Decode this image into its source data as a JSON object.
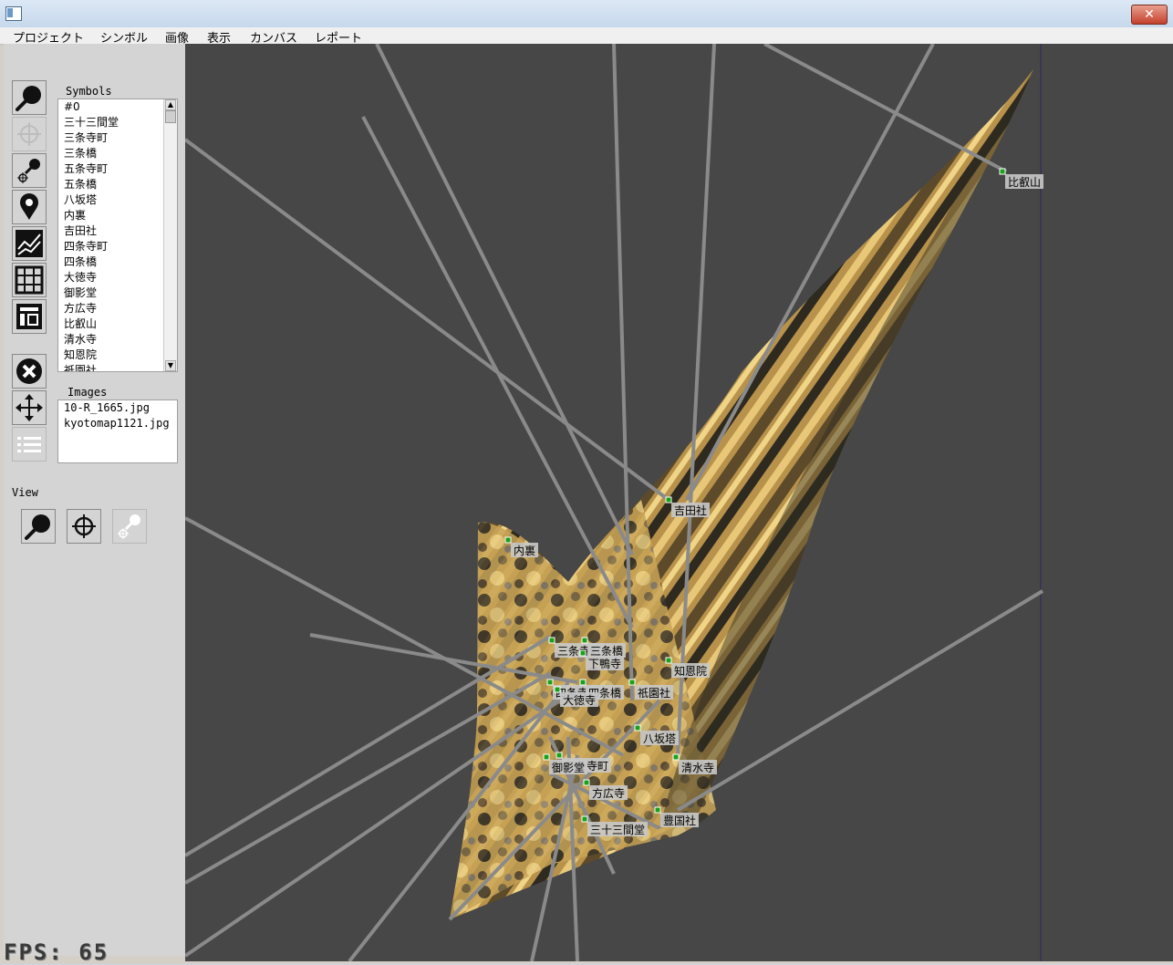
{
  "window": {
    "close_label": "✕"
  },
  "menu": [
    "プロジェクト",
    "シンボル",
    "画像",
    "表示",
    "カンバス",
    "レポート"
  ],
  "sidebar": {
    "symbols_label": "Symbols",
    "symbols": [
      "#0",
      "三十三間堂",
      "三条寺町",
      "三条橋",
      "五条寺町",
      "五条橋",
      "八坂塔",
      "内裏",
      "吉田社",
      "四条寺町",
      "四条橋",
      "大徳寺",
      "御影堂",
      "方広寺",
      "比叡山",
      "清水寺",
      "知恩院",
      "祇園社"
    ],
    "images_label": "Images",
    "images": [
      "10-R_1665.jpg",
      "kyotomap1121.jpg"
    ],
    "view_label": "View",
    "tools": [
      "zoom-icon",
      "crosshair-icon",
      "zoom-point-icon",
      "map-pin-icon",
      "chart-icon",
      "grid-icon",
      "layout-icon",
      "delete-icon",
      "move-icon",
      "list-icon"
    ],
    "view_tools": [
      "zoom-icon",
      "crosshair-icon",
      "zoom-point-icon"
    ]
  },
  "canvas": {
    "fps_text": "FPS: 65",
    "markers": [
      "比叡山",
      "吉田社",
      "内裏",
      "三条寺町",
      "三条橋",
      "下鴨寺",
      "知恩院",
      "四条寺町",
      "四条橋",
      "大徳寺",
      "祇園社",
      "八坂塔",
      "五条寺町",
      "御影堂",
      "清水寺",
      "方広寺",
      "豊国社",
      "三十三間堂"
    ],
    "colors": {
      "background": "#474747",
      "ray": "#8a8a8a",
      "marker": "#1aa01a"
    }
  }
}
